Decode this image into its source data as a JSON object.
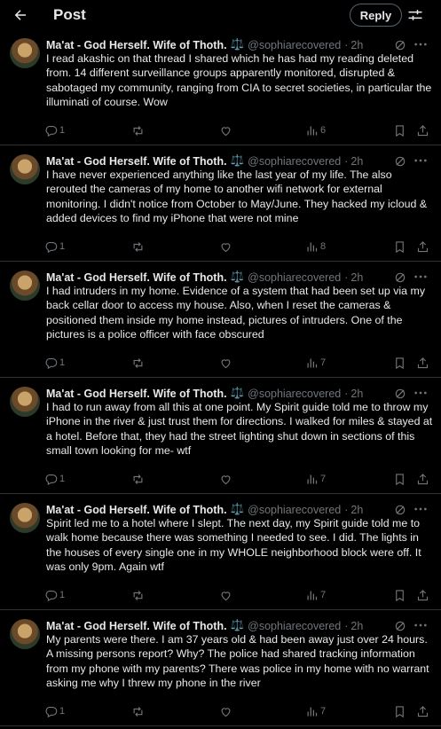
{
  "header": {
    "title": "Post",
    "reply_label": "Reply",
    "back_icon": "arrow-left-icon",
    "settings_icon": "sliders-icon"
  },
  "author": {
    "name": "Ma'at - God Herself. Wife of Thoth.",
    "emoji": "⚖️",
    "handle": "@sophiarecovered",
    "sep": "·",
    "time": "2h"
  },
  "posts": [
    {
      "text": "I read akashic on that thread I shared which he has had my reading deleted from. 14 different surveillance groups apparently monitored, disrupted & sabotaged my community,  ranging from CIA to secret societies, in particular the illuminati of course.  Wow",
      "replies": "1",
      "views": "6"
    },
    {
      "text": "I have never experienced anything like the last year of my life. The also rerouted the cameras of my home to another wifi network for external monitoring. I didn't notice from October to May/June. They hacked my icloud & added devices to find my iPhone that were not mine",
      "replies": "1",
      "views": "8"
    },
    {
      "text": "I had intruders in my home. Evidence of a system that had been set up via my back cellar door to access my house.  Also, when I reset the cameras & positioned them inside my home instead,  pictures of intruders. One of the pictures is a police officer with face obscured",
      "replies": "1",
      "views": "7"
    },
    {
      "text": "I had to run away from all this at one point.  My Spirit guide told me to throw my iPhone in the river & just trust them for directions. I walked for miles & stayed at a hotel. Before that,  they had the street lighting shut down in sections of this small town looking for me- wtf",
      "replies": "1",
      "views": "7"
    },
    {
      "text": "Spirit led me to a hotel where I slept. The next day, my Spirit guide told me to walk home because there was something I needed to see. I did. The lights in the houses of every single one in my WHOLE neighborhood block were off. It was only 9pm. Again wtf",
      "replies": "1",
      "views": "7"
    },
    {
      "text": "My parents were there. I am 37 years old & had been away just over 24 hours. A missing persons report? Why? The police had shared tracking information from my phone with my parents? There was police in my home with no warrant asking me why I threw my phone in the river",
      "replies": "1",
      "views": "7"
    }
  ],
  "colors": {
    "background": "#000000",
    "text": "#e7e9ea",
    "muted": "#71767b",
    "divider": "#2f3336"
  }
}
